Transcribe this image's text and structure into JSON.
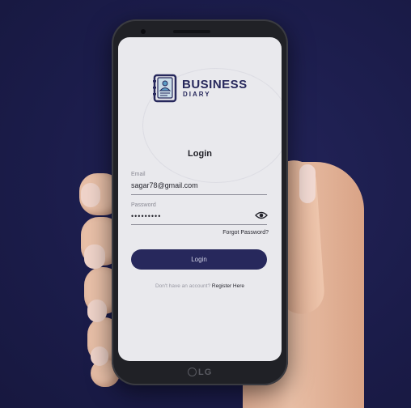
{
  "app": {
    "brand_name": "BUSINESS",
    "brand_sub": "DIARY",
    "logo_icon": "diary-book-icon"
  },
  "login": {
    "title": "Login",
    "email_label": "Email",
    "email_value": "sagar78@gmail.com",
    "password_label": "Password",
    "password_value": "•••••••••",
    "show_password_icon": "eye-icon",
    "forgot_password": "Forgot Password?",
    "submit_label": "Login",
    "no_account_text": "Don't have an account?",
    "register_link": "Register Here"
  },
  "device": {
    "brand": "LG"
  },
  "colors": {
    "background": "#1b1c4a",
    "primary": "#22245a",
    "screen": "#f1f1f4"
  }
}
